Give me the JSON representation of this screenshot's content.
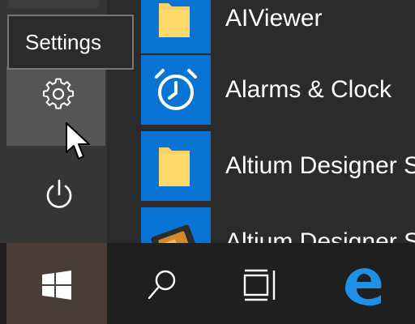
{
  "tooltip": {
    "text": "Settings"
  },
  "rail": {
    "items": [
      {
        "name": "settings",
        "icon": "gear-icon"
      },
      {
        "name": "power",
        "icon": "power-icon"
      }
    ]
  },
  "apps": [
    {
      "label": "AIViewer",
      "icon": "folder-icon"
    },
    {
      "label": "Alarms & Clock",
      "icon": "alarm-clock-icon"
    },
    {
      "label": "Altium Designer S",
      "icon": "folder-icon"
    },
    {
      "label": "Altium Designer S",
      "icon": "altium-app-icon"
    }
  ],
  "taskbar": {
    "items": [
      {
        "name": "start",
        "icon": "windows-logo-icon"
      },
      {
        "name": "search",
        "icon": "search-icon"
      },
      {
        "name": "task-view",
        "icon": "task-view-icon"
      },
      {
        "name": "edge",
        "icon": "edge-browser-icon"
      }
    ]
  },
  "colors": {
    "tile_blue": "#0a74d4",
    "folder_yellow": "#f6d36b",
    "edge_blue": "#1e90e6",
    "rail_hover": "#555555"
  }
}
